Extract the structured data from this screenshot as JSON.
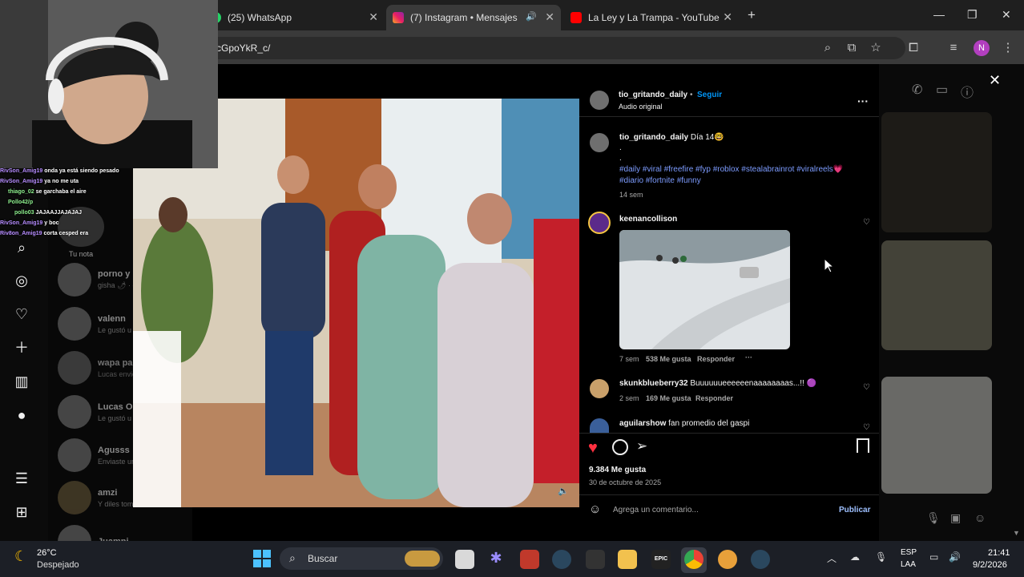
{
  "tabs": [
    {
      "title": "(25) WhatsApp",
      "icon": "whatsapp-icon"
    },
    {
      "title": "(7) Instagram • Mensajes",
      "icon": "instagram-icon"
    },
    {
      "title": "La Ley y La Trampa - YouTube",
      "icon": "youtube-icon"
    }
  ],
  "new_tab": "+",
  "address": "cGpoYkR_c/",
  "profile_initial": "N",
  "close_modal": "✕",
  "dm_list": {
    "your_note": "Tu nota",
    "items": [
      {
        "name": "porno y n",
        "preview": "gisha 🌶 · en"
      },
      {
        "name": "valenn",
        "preview": "Le gustó u"
      },
      {
        "name": "wapa pal",
        "preview": "Lucas envió"
      },
      {
        "name": "Lucas Ort",
        "preview": "Le gustó u"
      },
      {
        "name": "Agusss",
        "preview": "Enviaste ur"
      },
      {
        "name": "amzi",
        "preview": "Y diles tom"
      },
      {
        "name": "Juampi",
        "preview": ""
      }
    ]
  },
  "post": {
    "username": "tio_gritando_daily",
    "follow": "Seguir",
    "audio": "Audio original",
    "caption_user": "tio_gritando_daily",
    "caption_text": "Día 14🤓",
    "dot1": ".",
    "dot2": ".",
    "hashtags_line1": "#daily #viral #freefire #fyp #roblox #stealabrainrot #viralreels💗",
    "hashtags_line2": "#diario #fortnite #funny",
    "caption_time": "14 sem",
    "comments": [
      {
        "user": "keenancollison",
        "text": "",
        "time": "7 sem",
        "likes": "538 Me gusta",
        "reply": "Responder",
        "more": "···"
      },
      {
        "user": "skunkblueberry32",
        "text": "Buuuuuueeeeeenaaaaaaaas...!! 🟣",
        "time": "2 sem",
        "likes": "169 Me gusta",
        "reply": "Responder"
      },
      {
        "user": "aguilarshow",
        "text": "fan promedio del gaspi"
      }
    ],
    "like_count": "9.384 Me gusta",
    "date": "30 de octubre de 2025",
    "comment_placeholder": "Agrega un comentario...",
    "publish": "Publicar"
  },
  "stream_chat": [
    {
      "user": "RivSon_Amig19",
      "msg": "onda ya está siendo pesado"
    },
    {
      "user": "RivSon_Amig19",
      "msg": "ya no me uta"
    },
    {
      "user": "thiago_02",
      "msg": "se garchaba el aire"
    },
    {
      "user": "Pollo42/p",
      "msg": ""
    },
    {
      "user": "pollo03",
      "msg": "JAJAAJJAJAJAJ"
    },
    {
      "user": "RivSon_Amig19",
      "msg": "y boc"
    },
    {
      "user": "Riv8on_Amig19",
      "msg": "corta cesped era"
    }
  ],
  "taskbar": {
    "temp": "26°C",
    "weather": "Despejado",
    "search": "Buscar",
    "lang1": "ESP",
    "lang2": "LAA",
    "time": "21:41",
    "date": "9/2/2026"
  },
  "colors": {
    "accent": "#0095f6",
    "like": "#ff3040",
    "link": "#7d9cff"
  }
}
